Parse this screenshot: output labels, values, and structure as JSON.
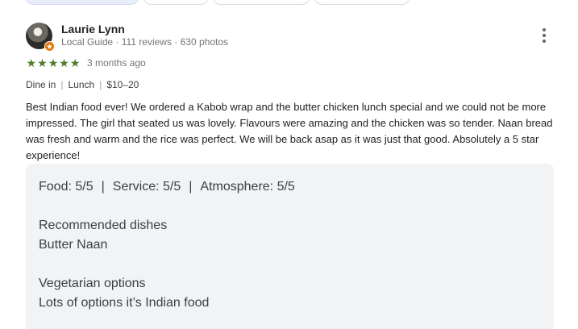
{
  "reviewer": {
    "name": "Laurie Lynn",
    "meta": "Local Guide · 111 reviews · 630 photos"
  },
  "rating": {
    "stars": 5,
    "date": "3 months ago",
    "star_color": "#4e7b2a"
  },
  "details": {
    "service": "Dine in",
    "meal": "Lunch",
    "price": "$10–20"
  },
  "review_text": "Best Indian food ever! We ordered a Kabob wrap and the butter chicken lunch special and we could not be more impressed. The girl that seated us was lovely. Flavours were amazing and the chicken was so tender. Naan bread was fresh and warm and the rice was perfect. We will be back asap as it was just that good. Absolutely a 5 star experience!",
  "summary": {
    "food": "Food: 5/5",
    "service": "Service: 5/5",
    "atmosphere": "Atmosphere: 5/5",
    "separator": "|",
    "recommended_heading": "Recommended dishes",
    "recommended_value": "Butter Naan",
    "vegetarian_heading": "Vegetarian options",
    "vegetarian_value": "Lots of options it’s Indian food"
  },
  "icons": {
    "more": "more-vert-icon",
    "badge": "local-guide-badge-icon",
    "star": "star-icon"
  }
}
